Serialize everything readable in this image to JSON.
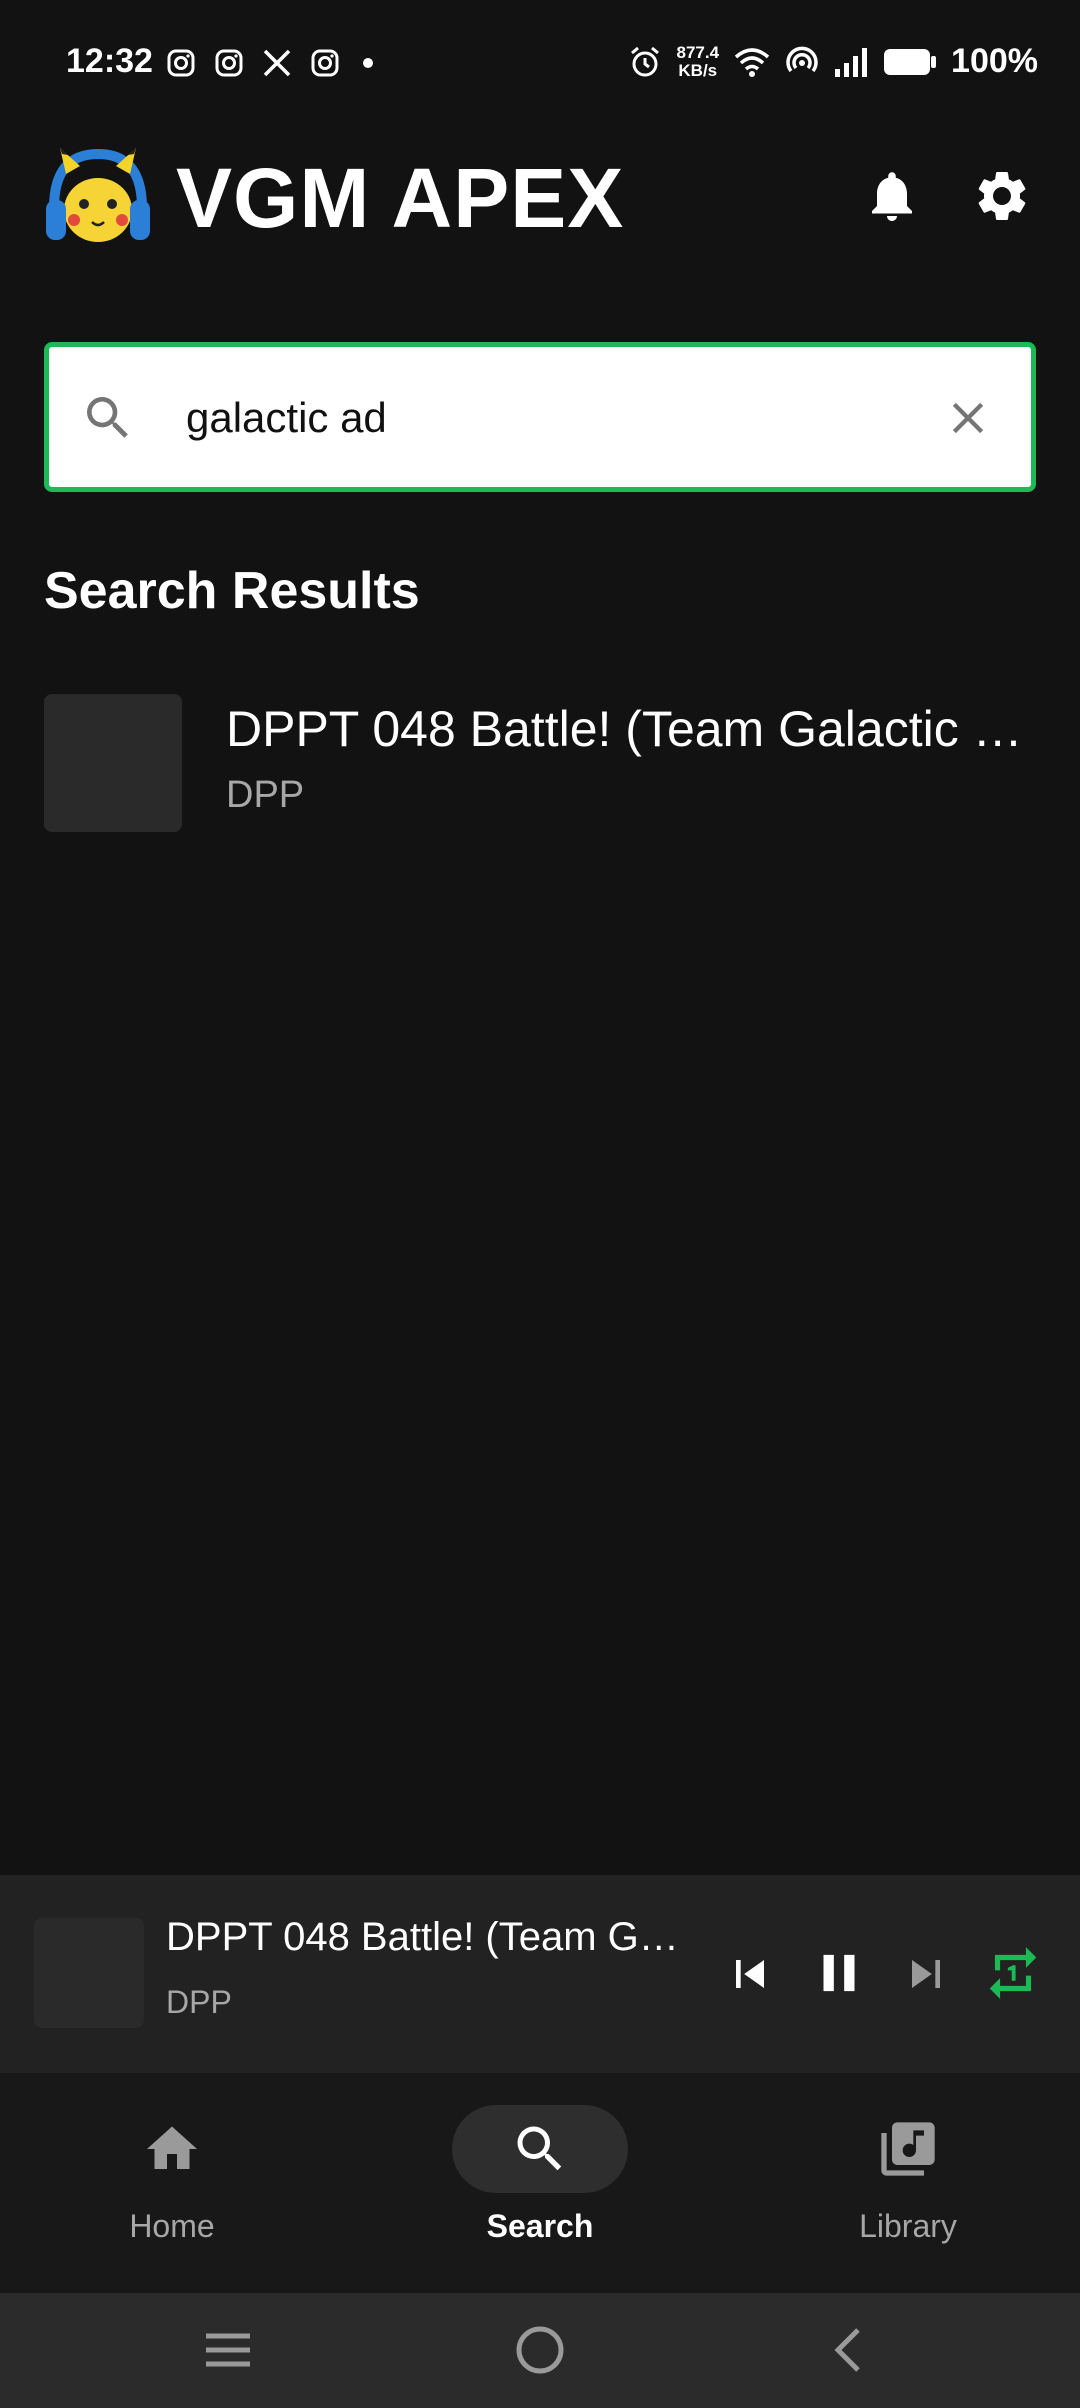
{
  "status_bar": {
    "time": "12:32",
    "notification_icons": [
      "instagram-icon",
      "instagram-icon",
      "x-icon",
      "instagram-icon",
      "dot-icon"
    ],
    "net_speed_value": "877.4",
    "net_speed_unit": "KB/s",
    "battery": "100%"
  },
  "header": {
    "title": "VGM APEX"
  },
  "search": {
    "value": "galactic ad"
  },
  "results": {
    "heading": "Search Results",
    "items": [
      {
        "title": "DPPT 048 Battle! (Team Galactic …",
        "subtitle": "DPP"
      }
    ]
  },
  "mini_player": {
    "title": "DPPT 048 Battle! (Team Gala…",
    "subtitle": "DPP",
    "repeat_mode": "repeat-one"
  },
  "bottom_nav": {
    "items": [
      {
        "label": "Home",
        "icon": "home-icon",
        "active": false
      },
      {
        "label": "Search",
        "icon": "search-icon",
        "active": true
      },
      {
        "label": "Library",
        "icon": "library-music-icon",
        "active": false
      }
    ]
  },
  "colors": {
    "accent": "#1db954",
    "background": "#121212",
    "surface": "#222222"
  }
}
